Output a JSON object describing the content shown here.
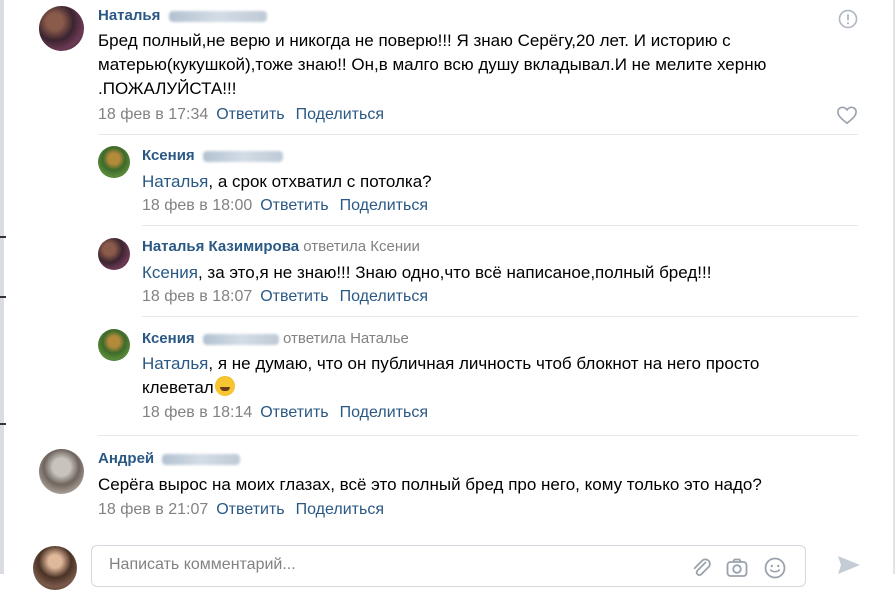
{
  "comments": [
    {
      "author": "Наталья",
      "author_hidden": "Казимирова",
      "text": "Бред полный,не верю и никогда не поверю!!! Я знаю Серёгу,20 лет. И историю с матерью(кукушкой),тоже знаю!! Он,в малго всю душу вкладывал.И не мелите херню .ПОЖАЛУЙСТА!!!",
      "date": "18 фев в 17:34",
      "reply_label": "Ответить",
      "share_label": "Поделиться",
      "replies": [
        {
          "author": "Ксения",
          "author_hidden": "Бакшеева",
          "replied_to": "",
          "mention": "Наталья",
          "text": ", а срок отхватил с потолка?",
          "date": "18 фев в 18:00",
          "reply_label": "Ответить",
          "share_label": "Поделиться"
        },
        {
          "author": "Наталья Казимирова",
          "replied_to": "ответила Ксении",
          "mention": "Ксения",
          "text": ", за это,я не знаю!!! Знаю одно,что всё написаное,полный бред!!!",
          "date": "18 фев в 18:07",
          "reply_label": "Ответить",
          "share_label": "Поделиться"
        },
        {
          "author": "Ксения",
          "author_hidden": "Бакшеева",
          "replied_to": "ответила Наталье",
          "mention": "Наталья",
          "text_line1": ", я не думаю, что он публичная личность чтоб блокнот на него просто",
          "text_line2": "клеветал",
          "emoji": "rofl-emoji",
          "date": "18 фев в 18:14",
          "reply_label": "Ответить",
          "share_label": "Поделиться"
        }
      ]
    },
    {
      "author": "Андрей",
      "author_hidden": "",
      "text": "Серёга вырос на моих глазах, всё это полный бред про него, кому только это надо?",
      "date": "18 фев в 21:07",
      "reply_label": "Ответить",
      "share_label": "Поделиться"
    }
  ],
  "composer": {
    "placeholder": "Написать комментарий..."
  },
  "icons": {
    "report": "report-icon",
    "like": "heart-icon",
    "attach": "paperclip-icon",
    "camera": "camera-icon",
    "emoji": "smile-icon",
    "send": "send-icon"
  },
  "colors": {
    "link": "#2a5885",
    "meta": "#828282",
    "divider": "#e7e8ec"
  }
}
